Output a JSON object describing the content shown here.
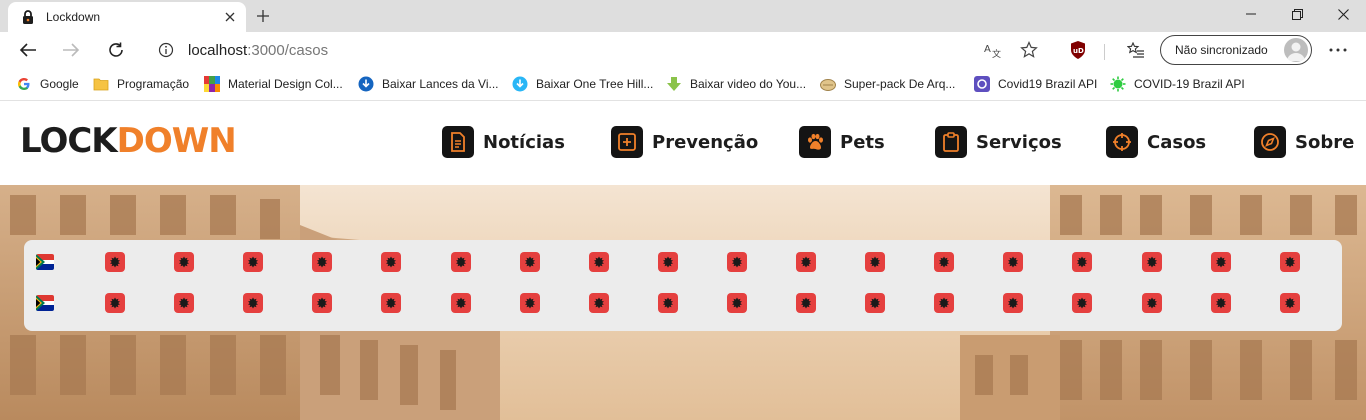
{
  "browser": {
    "tab_title": "Lockdown",
    "url_host": "localhost",
    "url_path": ":3000/casos",
    "sync_label": "Não sincronizado",
    "bookmarks": [
      {
        "label": "Google",
        "icon": "google-icon"
      },
      {
        "label": "Programação",
        "icon": "folder-icon"
      },
      {
        "label": "Material Design Col...",
        "icon": "palette-icon"
      },
      {
        "label": "Baixar Lances da Vi...",
        "icon": "download-icon"
      },
      {
        "label": "Baixar One Tree Hill...",
        "icon": "download-icon"
      },
      {
        "label": "Baixar video do You...",
        "icon": "arrow-down-icon"
      },
      {
        "label": "Super-pack De Arq...",
        "icon": "pack-icon"
      },
      {
        "label": "Covid19 Brazil API",
        "icon": "api-icon"
      },
      {
        "label": "COVID-19 Brazil API",
        "icon": "virus-icon"
      }
    ]
  },
  "site": {
    "logo_dark": "LOCK",
    "logo_orange": "DOWN",
    "nav": [
      {
        "label": "Notícias",
        "icon": "document-icon"
      },
      {
        "label": "Prevenção",
        "icon": "plus-square-icon"
      },
      {
        "label": "Pets",
        "icon": "paw-icon"
      },
      {
        "label": "Serviços",
        "icon": "clipboard-icon"
      },
      {
        "label": "Casos",
        "icon": "crosshair-icon"
      },
      {
        "label": "Sobre",
        "icon": "compass-icon"
      }
    ],
    "accent_color": "#f0802a"
  },
  "cases": {
    "rows": [
      {
        "lead_flag": "south-africa-flag",
        "flag_icon": "albania-flag",
        "flag_count": 18
      },
      {
        "lead_flag": "south-africa-flag",
        "flag_icon": "albania-flag",
        "flag_count": 18
      }
    ]
  }
}
